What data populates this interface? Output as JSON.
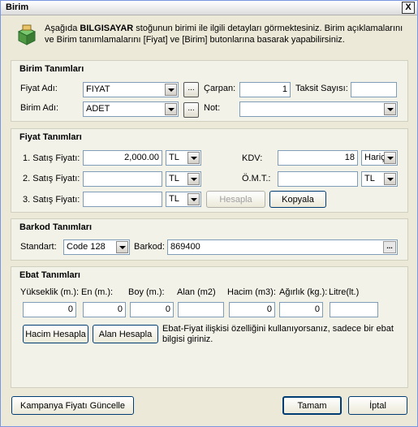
{
  "window": {
    "title": "Birim",
    "close_label": "X"
  },
  "intro": {
    "pre": "Aşağıda ",
    "bold": "BILGISAYAR",
    "post": " stoğunun birimi ile ilgili detayları görmektesiniz. Birim açıklamalarını ve Birim tanımlamalarını [Fiyat] ve [Birim] butonlarına basarak yapabilirsiniz."
  },
  "birim": {
    "title": "Birim Tanımları",
    "fiyat_adi_label": "Fiyat Adı:",
    "fiyat_adi_value": "FIYAT",
    "ellipsis": "...",
    "carpan_label": "Çarpan:",
    "carpan_value": "1",
    "taksit_label": "Taksit Sayısı:",
    "taksit_value": "",
    "birim_adi_label": "Birim Adı:",
    "birim_adi_value": "ADET",
    "not_label": "Not:",
    "not_value": ""
  },
  "fiyat": {
    "title": "Fiyat Tanımları",
    "satis1_label": "1. Satış Fiyatı:",
    "satis1_value": "2,000.00",
    "satis1_currency": "TL",
    "satis2_label": "2. Satış Fiyatı:",
    "satis2_value": "",
    "satis2_currency": "TL",
    "satis3_label": "3. Satış Fiyatı:",
    "satis3_value": "",
    "satis3_currency": "TL",
    "kdv_label": "KDV:",
    "kdv_value": "18",
    "kdv_mode": "Hariç",
    "omt_label": "Ö.M.T.:",
    "omt_value": "",
    "omt_currency": "TL",
    "hesapla_label": "Hesapla",
    "kopyala_label": "Kopyala"
  },
  "barkod": {
    "title": "Barkod Tanımları",
    "standart_label": "Standart:",
    "standart_value": "Code 128",
    "barkod_label": "Barkod:",
    "barkod_value": "869400",
    "dots": "..."
  },
  "ebat": {
    "title": "Ebat Tanımları",
    "yukseklik_label": "Yükseklik (m.):",
    "en_label": "En (m.):",
    "boy_label": "Boy (m.):",
    "alan_label": "Alan (m2)",
    "hacim_label": "Hacim (m3):",
    "agirlik_label": "Ağırlık (kg.):",
    "litre_label": "Litre(lt.)",
    "yukseklik_value": "0",
    "en_value": "0",
    "boy_value": "0",
    "alan_value": "",
    "hacim_value": "0",
    "agirlik_value": "0",
    "litre_value": "",
    "hacim_hesapla": "Hacim Hesapla",
    "alan_hesapla": "Alan Hesapla",
    "note": "Ebat-Fiyat ilişkisi özelliğini kullanıyorsanız, sadece bir ebat bilgisi giriniz."
  },
  "footer": {
    "kampanya_label": "Kampanya Fiyatı Güncelle",
    "tamam_label": "Tamam",
    "iptal_label": "İptal"
  }
}
